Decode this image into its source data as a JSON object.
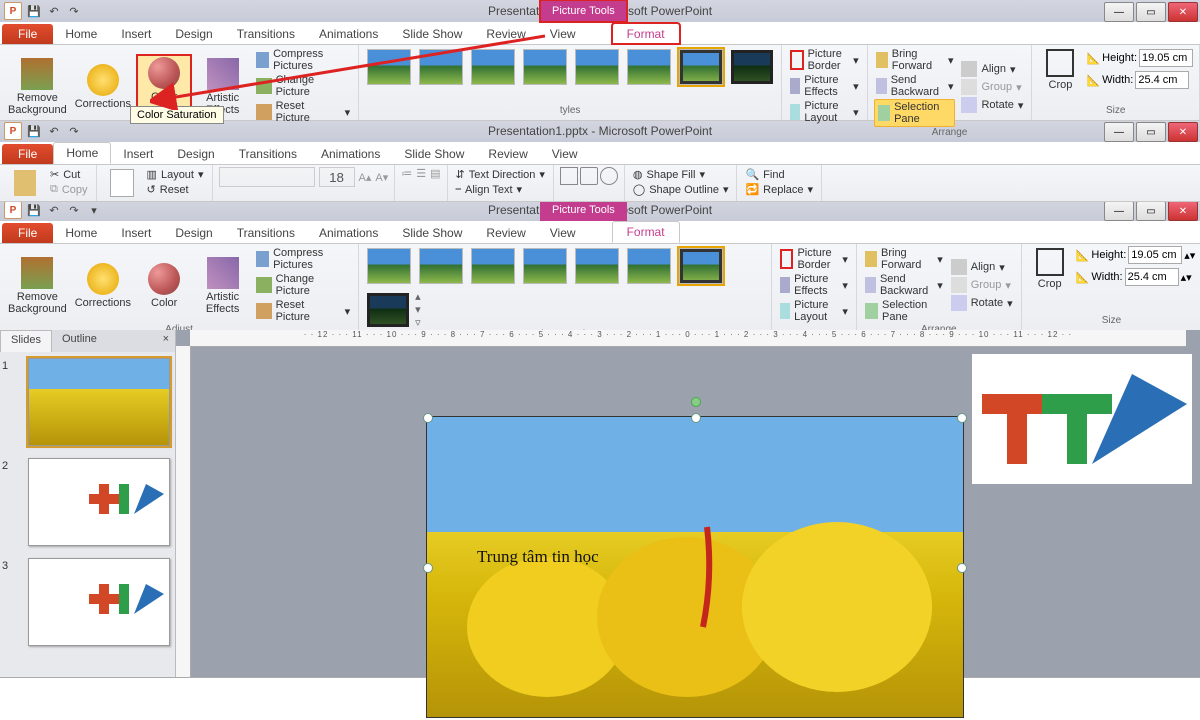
{
  "app_title": "Presentation1.pptx - Microsoft PowerPoint",
  "context_tab_title": "Picture Tools",
  "file_tab": "File",
  "tabs": [
    "Home",
    "Insert",
    "Design",
    "Transitions",
    "Animations",
    "Slide Show",
    "Review",
    "View"
  ],
  "format_tab": "Format",
  "adjust": {
    "remove_bg": "Remove\nBackground",
    "corrections": "Corrections",
    "color": "Color",
    "artistic": "Artistic\nEffects",
    "compress": "Compress Pictures",
    "change": "Change Picture",
    "reset": "Reset Picture",
    "label": "Adjust"
  },
  "picstyles_label": "Picture Styles",
  "picstyles_short": "tyles",
  "pic_border": "Picture Border",
  "pic_effects": "Picture Effects",
  "pic_layout": "Picture Layout",
  "arrange": {
    "bring_forward": "Bring Forward",
    "send_backward": "Send Backward",
    "selection_pane": "Selection Pane",
    "align": "Align",
    "group": "Group",
    "rotate": "Rotate",
    "label": "Arrange"
  },
  "crop": "Crop",
  "height_lbl": "Height:",
  "width_lbl": "Width:",
  "height_val": "19.05 cm",
  "width_val": "25.4 cm",
  "size_lbl": "Size",
  "tooltip_color_sat": "Color Saturation",
  "home": {
    "cut": "Cut",
    "copy": "Copy",
    "layout": "Layout",
    "reset": "Reset",
    "font_size": "18",
    "text_direction": "Text Direction",
    "align_text": "Align Text",
    "shape_fill": "Shape Fill",
    "shape_outline": "Shape Outline",
    "find": "Find",
    "replace": "Replace"
  },
  "thumbs_tabs": {
    "slides": "Slides",
    "outline": "Outline"
  },
  "slide_numbers": [
    "1",
    "2",
    "3"
  ],
  "slide_text": "Trung tâm tin học",
  "ruler_text": "· · 12 · · · 11 · · · 10 · · · 9 · · · 8 · · · 7 · · · 6 · · · 5 · · · 4 · · · 3 · · · 2 · · · 1 · · · 0 · · · 1 · · · 2 · · · 3 · · · 4 · · · 5 · · · 6 · · · 7 · · · 8 · · · 9 · · · 10 · · · 11 · · · 12 · ·"
}
